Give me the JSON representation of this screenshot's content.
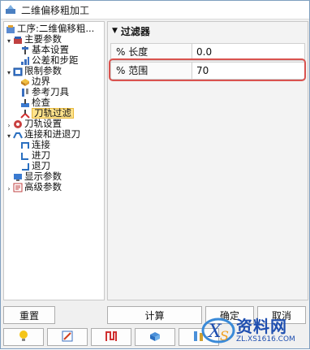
{
  "window": {
    "title": "二维偏移粗加工"
  },
  "tree": {
    "items": [
      {
        "label": "工序:二维偏移粗...",
        "icon": "operation-icon"
      },
      {
        "label": "主要参数",
        "icon": "main-params-icon"
      },
      {
        "label": "基本设置",
        "icon": "basic-settings-icon"
      },
      {
        "label": "公差和步距",
        "icon": "tolerance-icon"
      },
      {
        "label": "限制参数",
        "icon": "limit-params-icon"
      },
      {
        "label": "边界",
        "icon": "boundary-icon"
      },
      {
        "label": "参考刀具",
        "icon": "reference-tool-icon"
      },
      {
        "label": "检查",
        "icon": "check-icon"
      },
      {
        "label": "刀轨过滤",
        "icon": "toolpath-filter-icon"
      },
      {
        "label": "刀轨设置",
        "icon": "toolpath-settings-icon"
      },
      {
        "label": "连接和进退刀",
        "icon": "link-icon"
      },
      {
        "label": "连接",
        "icon": "connect-icon"
      },
      {
        "label": "进刀",
        "icon": "lead-in-icon"
      },
      {
        "label": "退刀",
        "icon": "lead-out-icon"
      },
      {
        "label": "显示参数",
        "icon": "display-params-icon"
      },
      {
        "label": "高级参数",
        "icon": "advanced-params-icon"
      }
    ]
  },
  "props": {
    "group": "过滤器",
    "rows": [
      {
        "label": "% 长度",
        "value": "0.0"
      },
      {
        "label": "% 范围",
        "value": "70"
      }
    ]
  },
  "buttons": {
    "reset": "重置",
    "calculate": "计算",
    "ok": "确定",
    "cancel": "取消"
  },
  "icon_buttons": [
    "lightbulb-icon",
    "edit-icon",
    "toolpath-icon",
    "simulate-icon",
    "tools-icon"
  ],
  "watermark": {
    "text": "资料网",
    "sub": "ZL.XS1616.COM"
  },
  "colors": {
    "highlight": "#d9534f",
    "selected_bg": "#ffe38c",
    "accent": "#1f4fb0"
  }
}
